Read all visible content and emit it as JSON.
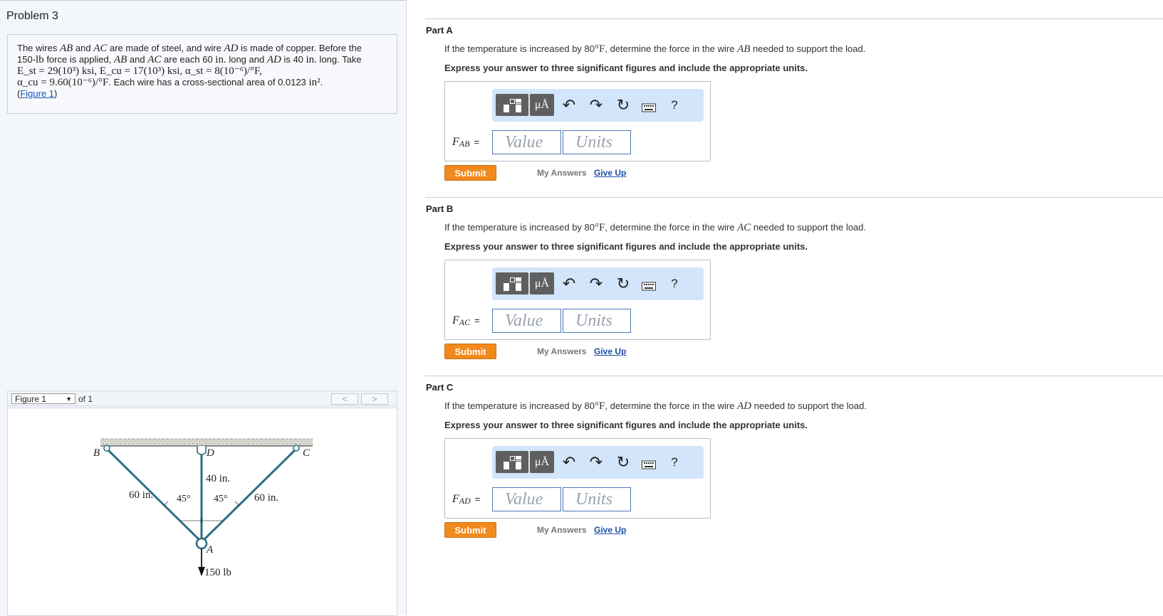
{
  "problem": {
    "title": "Problem 3",
    "statement": {
      "t1": "The wires ",
      "ab": "AB",
      "t2": " and ",
      "ac": "AC",
      "t3": " are made of steel, and wire ",
      "ad": "AD",
      "t4": " is made of copper. Before the",
      "t5": "150-",
      "lb": "lb",
      "t6": " force is applied, ",
      "ab2": "AB",
      "t7": " and ",
      "ac2": "AC",
      "t8": " are each 60 ",
      "in1": "in.",
      "t9": " long and ",
      "ad2": "AD",
      "t10": " is 40 ",
      "in2": "in.",
      "t11": " long. Take",
      "line3": "E_st = 29(10³) ksi, E_cu = 17(10³) ksi, α_st = 8(10⁻⁶)/°F,",
      "line4a": "α_cu = 9.60(10⁻⁶)/°F",
      "line4b": ". Each wire has a cross-sectional area of 0.0123 ",
      "area_unit": "in²",
      "line4c": ".",
      "figure_link": "Figure 1"
    }
  },
  "figure_nav": {
    "selected": "Figure 1",
    "of_label": "of 1",
    "prev": "<",
    "next": ">"
  },
  "figure": {
    "label_B": "B",
    "label_C": "C",
    "label_D": "D",
    "label_A": "A",
    "len_AD": "40 in.",
    "len_AB": "60 in.",
    "len_AC": "60 in.",
    "angle_left": "45°",
    "angle_right": "45°",
    "load": "150 lb"
  },
  "instruction": "Express your answer to three significant figures and include the appropriate units.",
  "toolbar": {
    "mu_label": "μÅ",
    "undo_icon": "undo-icon",
    "redo_icon": "redo-icon",
    "reset_icon": "reset-icon",
    "keyboard_icon": "keyboard-icon",
    "help_label": "?"
  },
  "parts": [
    {
      "label": "Part A",
      "q_pre": "If the temperature is increased by 80",
      "q_unit": "°F",
      "q_mid": ", determine the force in the wire ",
      "q_wire": "AB",
      "q_post": " needed to support the load.",
      "var": "F",
      "sub": "AB",
      "eq": "=",
      "value_placeholder": "Value",
      "units_placeholder": "Units",
      "submit": "Submit",
      "my_answers": "My Answers",
      "give_up": "Give Up"
    },
    {
      "label": "Part B",
      "q_pre": "If the temperature is increased by 80",
      "q_unit": "°F",
      "q_mid": ", determine the force in the wire ",
      "q_wire": "AC",
      "q_post": " needed to support the load.",
      "var": "F",
      "sub": "AC",
      "eq": "=",
      "value_placeholder": "Value",
      "units_placeholder": "Units",
      "submit": "Submit",
      "my_answers": "My Answers",
      "give_up": "Give Up"
    },
    {
      "label": "Part C",
      "q_pre": "If the temperature is increased by 80",
      "q_unit": "°F",
      "q_mid": ", determine the force in the wire ",
      "q_wire": "AD",
      "q_post": " needed to support the load.",
      "var": "F",
      "sub": "AD",
      "eq": "=",
      "value_placeholder": "Value",
      "units_placeholder": "Units",
      "submit": "Submit",
      "my_answers": "My Answers",
      "give_up": "Give Up"
    }
  ]
}
